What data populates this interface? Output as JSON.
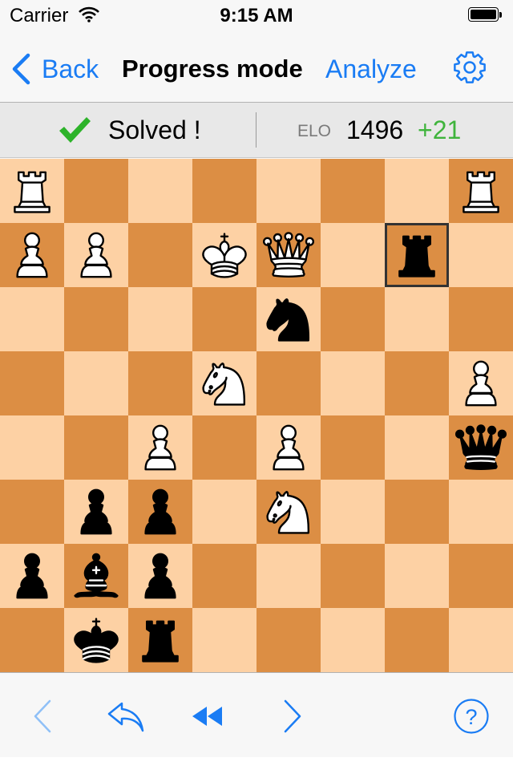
{
  "status_bar": {
    "carrier": "Carrier",
    "time": "9:15 AM"
  },
  "nav": {
    "back_label": "Back",
    "title": "Progress mode",
    "analyze_label": "Analyze"
  },
  "info": {
    "solved_text": "Solved !",
    "elo_label": "ELO",
    "elo_value": "1496",
    "elo_delta": "+21"
  },
  "colors": {
    "accent": "#1a7cf4",
    "light_square": "#fdd1a4",
    "dark_square": "#dc8e44",
    "positive": "#3fb43c"
  },
  "board": {
    "highlighted_square": "g7",
    "pieces": [
      {
        "square": "a8",
        "piece": "rook",
        "color": "white"
      },
      {
        "square": "h8",
        "piece": "rook",
        "color": "white"
      },
      {
        "square": "a7",
        "piece": "pawn",
        "color": "white"
      },
      {
        "square": "b7",
        "piece": "pawn",
        "color": "white"
      },
      {
        "square": "d7",
        "piece": "king",
        "color": "white"
      },
      {
        "square": "e7",
        "piece": "queen",
        "color": "white"
      },
      {
        "square": "g7",
        "piece": "rook",
        "color": "black"
      },
      {
        "square": "e6",
        "piece": "knight",
        "color": "black"
      },
      {
        "square": "d5",
        "piece": "knight",
        "color": "white"
      },
      {
        "square": "h5",
        "piece": "pawn",
        "color": "white"
      },
      {
        "square": "c4",
        "piece": "pawn",
        "color": "white"
      },
      {
        "square": "e4",
        "piece": "pawn",
        "color": "white"
      },
      {
        "square": "h4",
        "piece": "queen",
        "color": "black"
      },
      {
        "square": "b3",
        "piece": "pawn",
        "color": "black"
      },
      {
        "square": "c3",
        "piece": "pawn",
        "color": "black"
      },
      {
        "square": "e3",
        "piece": "knight",
        "color": "white"
      },
      {
        "square": "a2",
        "piece": "pawn",
        "color": "black"
      },
      {
        "square": "b2",
        "piece": "bishop",
        "color": "black"
      },
      {
        "square": "c2",
        "piece": "pawn",
        "color": "black"
      },
      {
        "square": "b1",
        "piece": "king",
        "color": "black"
      },
      {
        "square": "c1",
        "piece": "rook",
        "color": "black"
      }
    ]
  },
  "toolbar": {
    "icons": [
      "previous-move-icon",
      "undo-icon",
      "rewind-icon",
      "next-move-icon",
      "help-icon"
    ]
  }
}
